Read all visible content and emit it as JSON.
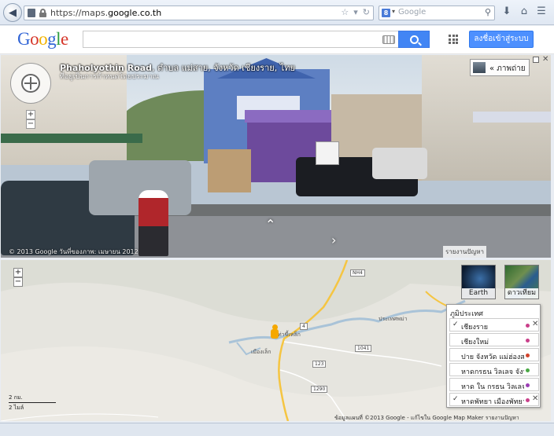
{
  "browser": {
    "url_prefix": "https://maps.",
    "url_domain": "google.co.th",
    "search_placeholder": "Google",
    "search_engine_badge": "8"
  },
  "header": {
    "logo_letters": [
      "G",
      "o",
      "o",
      "g",
      "l",
      "e"
    ],
    "signin_label": "ลงชื่อเข้าสู่ระบบ"
  },
  "streetview": {
    "title_bold": "Phaholyothin Road",
    "title_rest": ", ตำบล แม่สาย, จังหวัด เชียงราย, ไทย",
    "subtitle": "ที่อยู่เป็นการกำหนดโดยประมาณ",
    "photo_tab": "« ภาพถ่าย",
    "copyright": "© 2013 Google   วันที่ของภาพ: เมษายน 2012",
    "report": "รายงานปัญหา",
    "zoom_in": "+",
    "zoom_out": "−"
  },
  "map": {
    "zoom_in": "+",
    "zoom_out": "−",
    "earth_label": "Earth",
    "satellite_label": "ดาวเทียม",
    "layers_header": "ภูมิประเทศ",
    "layers": [
      {
        "checked": "✓",
        "label": "เชียงราย",
        "color": "#c9408a",
        "close": "✕"
      },
      {
        "checked": "",
        "label": "เชียงใหม่",
        "color": "#c9408a",
        "close": ""
      },
      {
        "checked": "",
        "label": "ปาย จังหวัด แม่ฮ่องสอน",
        "color": "#d2442d",
        "close": ""
      },
      {
        "checked": "",
        "label": "หาดกรธน วิลเลจ จังหวัด",
        "color": "#4aa845",
        "close": ""
      },
      {
        "checked": "",
        "label": "หาด ใน กรธน วิลเลจ",
        "color": "#9b3fb5",
        "close": ""
      },
      {
        "checked": "✓",
        "label": "หาดพัทยา เมืองพัทยา",
        "color": "#c9408a",
        "close": "✕"
      }
    ],
    "scale_km": "2 กม.",
    "scale_mi": "2 ไมล์",
    "copyright": "ข้อมูลแผนที่ ©2013 Google -  แก้ไขใน Google Map Maker  รายงานปัญหา",
    "road_labels": [
      "NH4",
      "4",
      "1041",
      "123",
      "1290"
    ],
    "place_labels": [
      "ท่าขี้เหล็ก",
      "ประเทศพม่า",
      "เมืองเล็ก"
    ]
  },
  "colors": {
    "google_blue": "#4285f4",
    "signin_blue": "#4d90fe",
    "river": "#a9c3d8",
    "road_major": "#f5c542"
  }
}
